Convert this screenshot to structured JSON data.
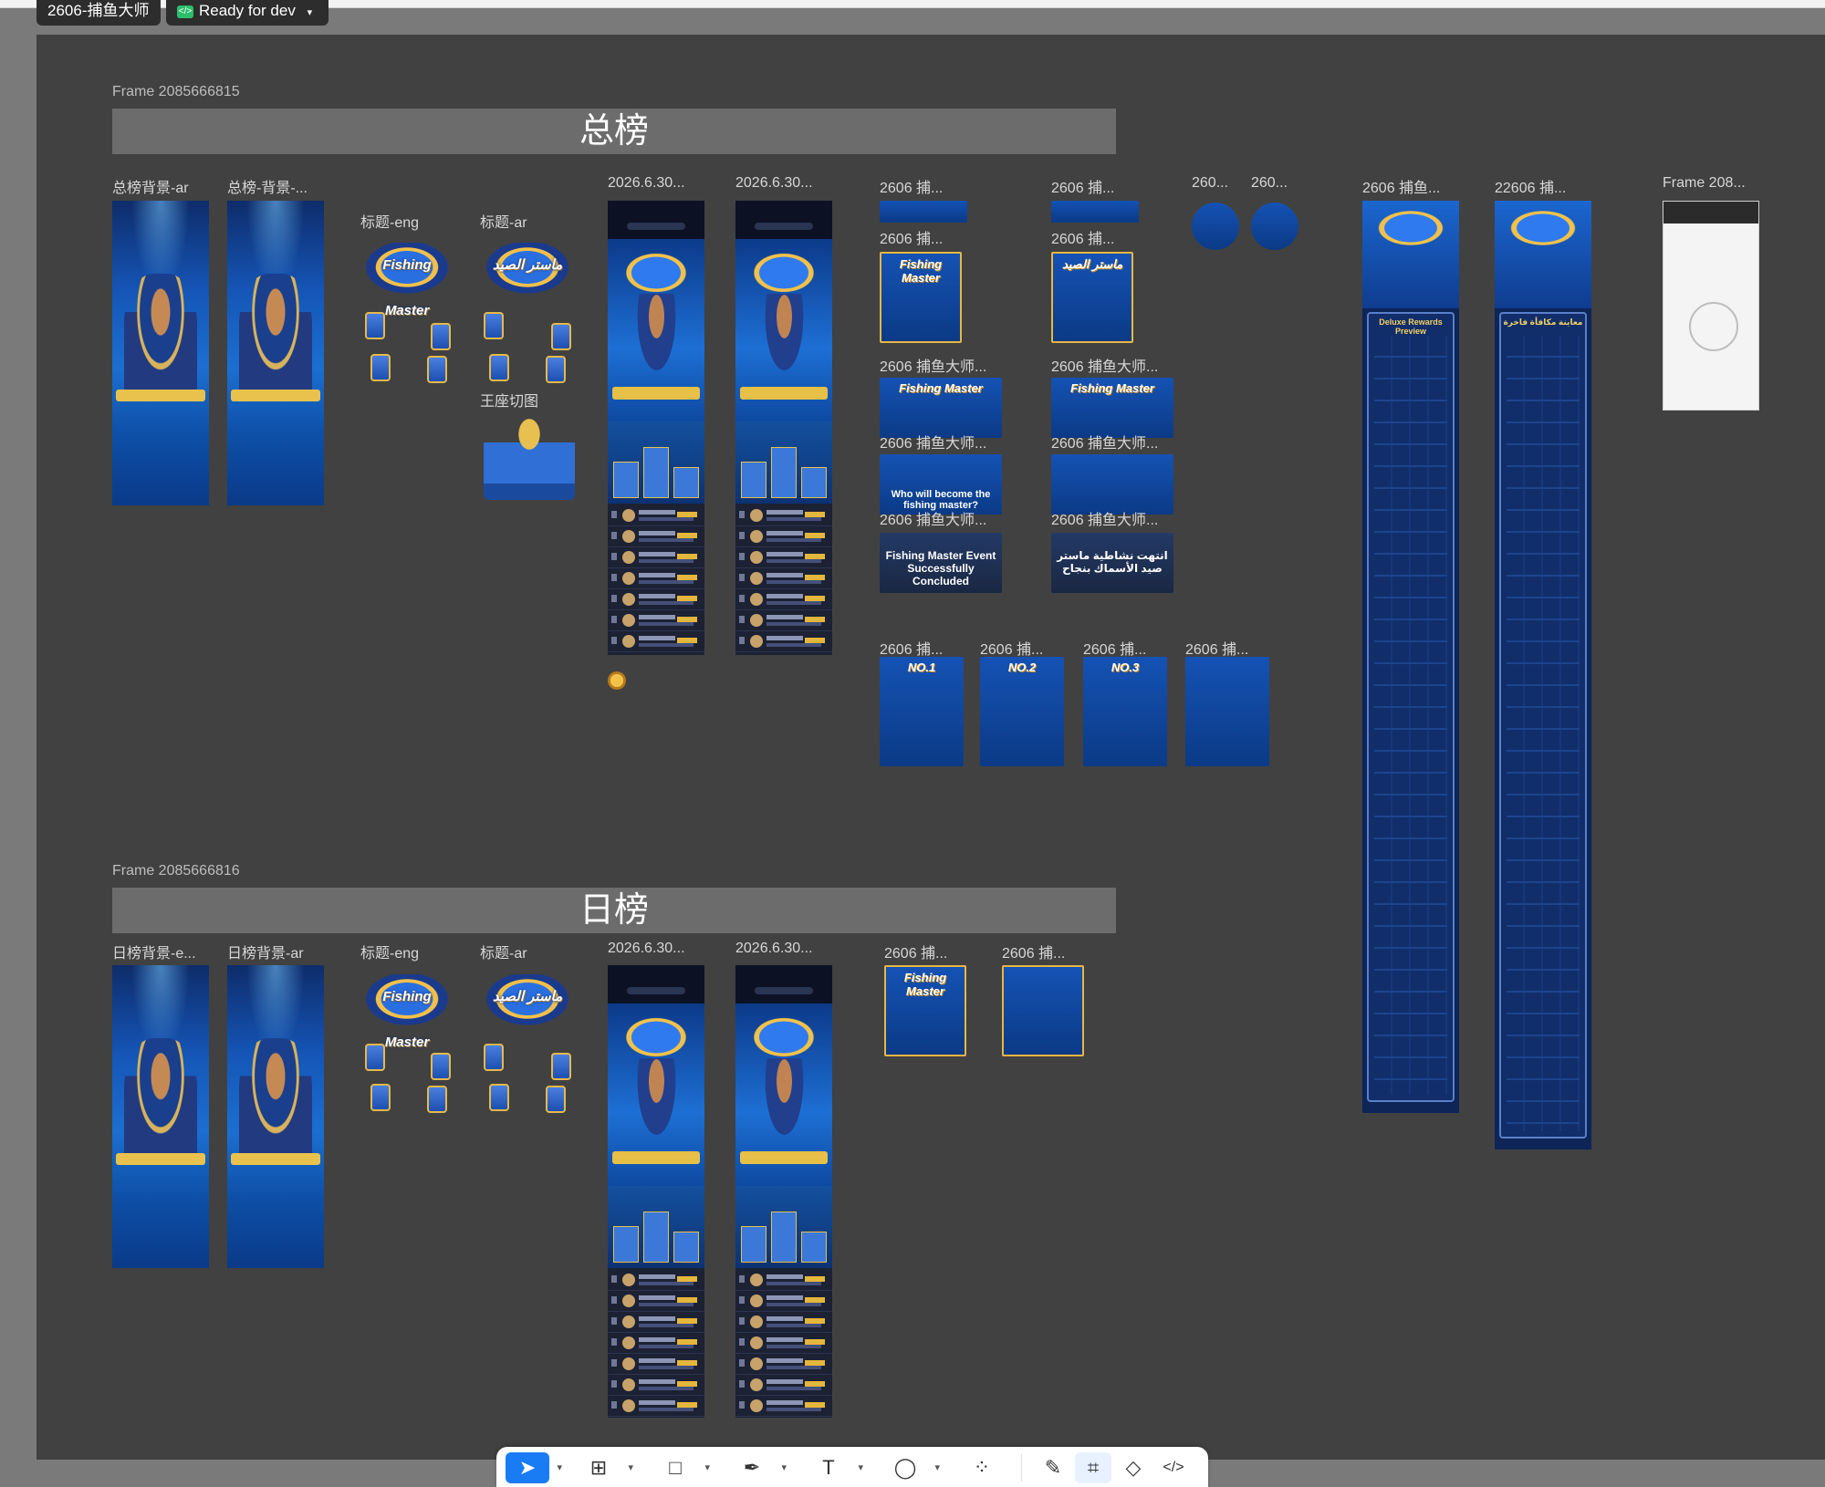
{
  "file": {
    "name": "2606-捕鱼大师",
    "status_label": "Ready for dev",
    "status_icon": "code-icon"
  },
  "sections": [
    {
      "frame_label": "Frame 2085666815",
      "banner": "总榜",
      "bg_labels": [
        "总榜背景-ar",
        "总榜-背景-..."
      ],
      "title_labels": [
        "标题-eng",
        "标题-ar"
      ],
      "slice_label": "王座切图",
      "phone_labels": [
        "2026.6.30...",
        "2026.6.30..."
      ]
    },
    {
      "frame_label": "Frame 2085666816",
      "banner": "日榜",
      "bg_labels": [
        "日榜背景-e...",
        "日榜背景-ar"
      ],
      "title_labels": [
        "标题-eng",
        "标题-ar"
      ],
      "phone_labels": [
        "2026.6.30...",
        "2026.6.30..."
      ]
    }
  ],
  "art": {
    "title_eng": "Fishing Master",
    "title_ar": "ماستر الصيد",
    "concluded_eng": "Fishing Master Event Successfully Concluded",
    "concluded_ar": "انتهت نشاطية ماستر صيد الأسماك بنجاح",
    "who_eng": "Who will become the fishing master?",
    "rank1": "NO.1",
    "rank2": "NO.2",
    "rank3": "NO.3",
    "long_eng_header": "Deluxe Rewards Preview",
    "long_ar_header": "معاينة مكافأة فاخرة"
  },
  "labels": {
    "c1a": "2606 捕...",
    "c1b": "2606 捕...",
    "c1c": "2606 捕...",
    "c1d": "2606 捕...",
    "c2a": "2606 捕鱼大师...",
    "c2b": "2606 捕鱼大师...",
    "c2c": "2606 捕鱼大师...",
    "c2d": "2606 捕鱼大师...",
    "c2e": "2606 捕鱼大师...",
    "c2f": "2606 捕鱼大师...",
    "s1": "260...",
    "s2": "260...",
    "long1": "2606 捕鱼...",
    "long2": "22606 捕...",
    "frame208": "Frame 208...",
    "r1": "2606 捕...",
    "r2": "2606 捕...",
    "r3": "2606 捕...",
    "r4": "2606 捕...",
    "d1": "2606 捕...",
    "d2": "2606 捕..."
  },
  "toolbar": [
    {
      "name": "move-tool",
      "icon": "cursor-icon",
      "selected": true
    },
    {
      "name": "frame-tool",
      "icon": "frame-icon"
    },
    {
      "name": "shape-tool",
      "icon": "rectangle-icon"
    },
    {
      "name": "pen-tool",
      "icon": "pen-icon"
    },
    {
      "name": "text-tool",
      "icon": "text-icon"
    },
    {
      "name": "comment-tool",
      "icon": "comment-icon"
    },
    {
      "name": "actions-tool",
      "icon": "actions-icon"
    },
    {
      "name": "draw-mode",
      "icon": "pencil-icon"
    },
    {
      "name": "design-mode",
      "icon": "design-icon"
    },
    {
      "name": "prototype-mode",
      "icon": "prototype-icon"
    },
    {
      "name": "dev-mode",
      "icon": "code-icon"
    }
  ]
}
